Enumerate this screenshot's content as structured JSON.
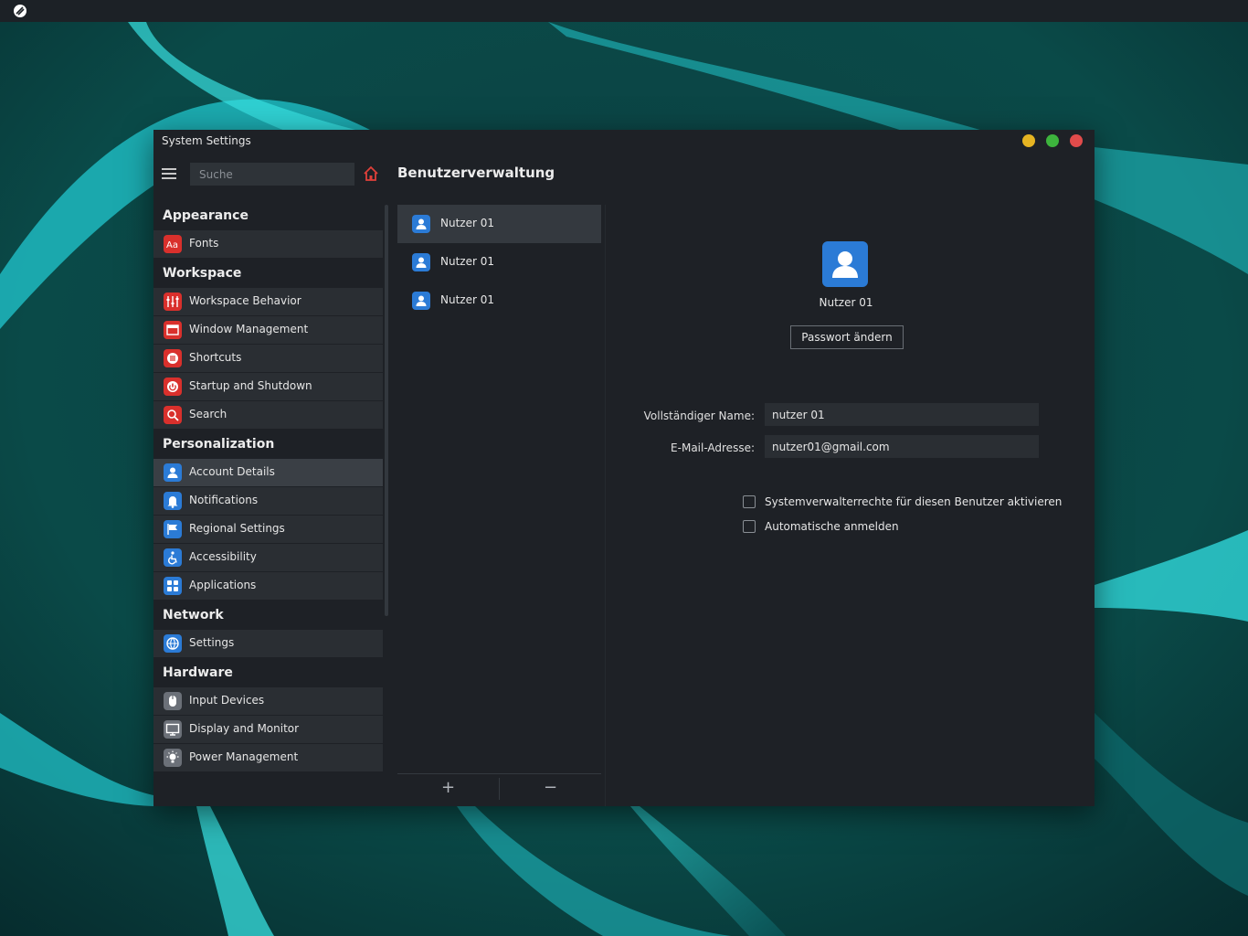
{
  "colors": {
    "accent_red": "#d9302c",
    "accent_blue": "#2b7bd6",
    "window_bg": "#1e2126",
    "minimize": "#e6b422",
    "maximize": "#3db43d",
    "close": "#e14b4b"
  },
  "window": {
    "title": "System Settings"
  },
  "toolbar": {
    "search_placeholder": "Suche",
    "home_icon": "home-icon",
    "page_title": "Benutzerverwaltung"
  },
  "sidebar": {
    "sections": [
      {
        "header": "Appearance",
        "items": [
          {
            "label": "Fonts",
            "icon": "fonts-icon"
          }
        ]
      },
      {
        "header": "Workspace",
        "items": [
          {
            "label": "Workspace Behavior",
            "icon": "sliders-icon"
          },
          {
            "label": "Window Management",
            "icon": "window-icon"
          },
          {
            "label": "Shortcuts",
            "icon": "shortcuts-icon"
          },
          {
            "label": "Startup and Shutdown",
            "icon": "power-icon"
          },
          {
            "label": "Search",
            "icon": "search-icon"
          }
        ]
      },
      {
        "header": "Personalization",
        "items": [
          {
            "label": "Account Details",
            "icon": "user-icon",
            "active": true
          },
          {
            "label": "Notifications",
            "icon": "bell-icon"
          },
          {
            "label": "Regional Settings",
            "icon": "flag-icon"
          },
          {
            "label": "Accessibility",
            "icon": "accessibility-icon"
          },
          {
            "label": "Applications",
            "icon": "apps-grid-icon"
          }
        ]
      },
      {
        "header": "Network",
        "items": [
          {
            "label": "Settings",
            "icon": "globe-icon"
          }
        ]
      },
      {
        "header": "Hardware",
        "items": [
          {
            "label": "Input Devices",
            "icon": "mouse-icon"
          },
          {
            "label": "Display and Monitor",
            "icon": "monitor-icon"
          },
          {
            "label": "Power Management",
            "icon": "bulb-icon"
          }
        ]
      }
    ]
  },
  "user_list": {
    "users": [
      {
        "name": "Nutzer 01",
        "selected": true
      },
      {
        "name": "Nutzer 01"
      },
      {
        "name": "Nutzer 01"
      }
    ],
    "add_label": "+",
    "remove_label": "−"
  },
  "detail": {
    "user_name": "Nutzer 01",
    "change_password_label": "Passwort ändern",
    "full_name_label": "Vollständiger Name:",
    "full_name_value": "nutzer 01",
    "email_label": "E-Mail-Adresse:",
    "email_value": "nutzer01@gmail.com",
    "admin_checkbox_label": "Systemverwalterrechte für diesen Benutzer aktivieren",
    "autologin_checkbox_label": "Automatische anmelden"
  }
}
